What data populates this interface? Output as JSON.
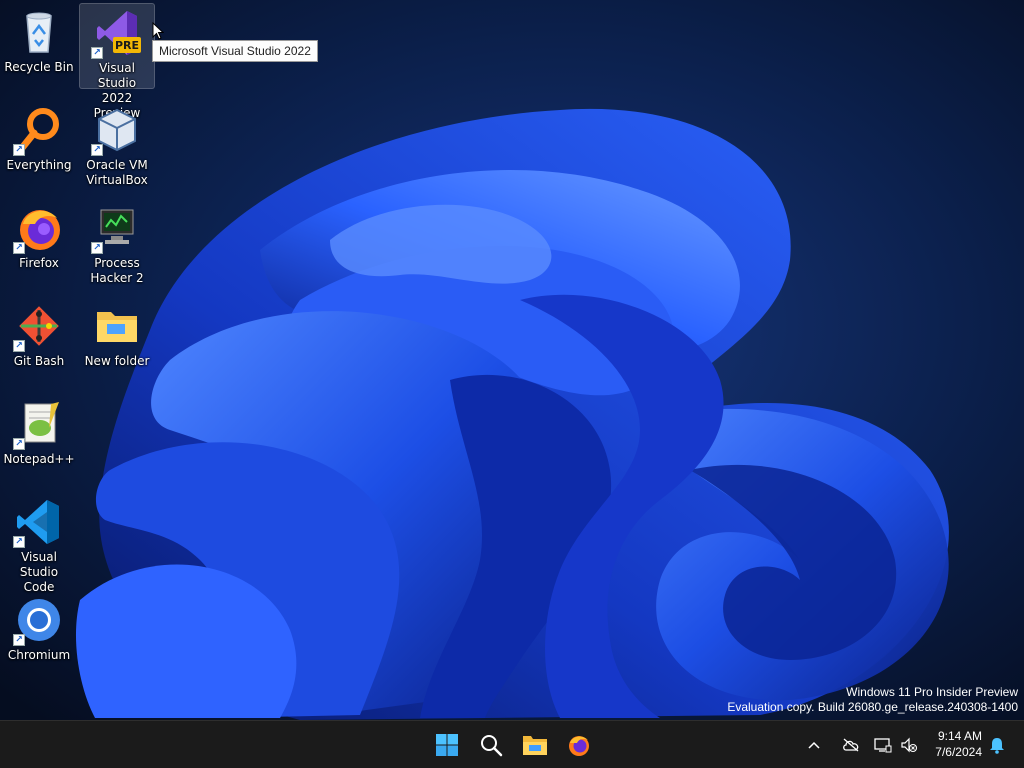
{
  "desktop": {
    "icons": [
      {
        "label": "Recycle Bin",
        "icon": "recycle-bin-icon"
      },
      {
        "label": "Visual Studio 2022 Preview",
        "label_l1": "Visual Studio",
        "label_l2": "2022 Preview",
        "icon": "visual-studio-preview-icon",
        "badge": "PRE"
      },
      {
        "label": "Everything",
        "icon": "everything-search-icon"
      },
      {
        "label": "Oracle VM VirtualBox",
        "label_l1": "Oracle VM",
        "label_l2": "VirtualBox",
        "icon": "virtualbox-icon"
      },
      {
        "label": "Firefox",
        "icon": "firefox-icon"
      },
      {
        "label": "Process Hacker 2",
        "label_l1": "Process",
        "label_l2": "Hacker 2",
        "icon": "process-hacker-icon"
      },
      {
        "label": "Git Bash",
        "icon": "git-bash-icon"
      },
      {
        "label": "New folder",
        "icon": "folder-icon"
      },
      {
        "label": "Notepad++",
        "icon": "notepad-plus-plus-icon"
      },
      {
        "label": "Visual Studio Code",
        "label_l1": "Visual Studio",
        "label_l2": "Code",
        "icon": "vscode-icon"
      },
      {
        "label": "Chromium",
        "icon": "chromium-icon"
      }
    ],
    "tooltip": "Microsoft Visual Studio 2022"
  },
  "watermark": {
    "line1": "Windows 11 Pro Insider Preview",
    "line2": "Evaluation copy. Build 26080.ge_release.240308-1400"
  },
  "taskbar": {
    "pinned": [
      "start-icon",
      "search-icon",
      "file-explorer-icon",
      "firefox-icon"
    ],
    "tray_icons": [
      "chevron-up-icon",
      "cloud-offline-icon",
      "network-icon",
      "volume-muted-icon"
    ],
    "time": "9:14 AM",
    "date": "7/6/2024",
    "notification_icon": "bell-icon"
  },
  "colors": {
    "wallpaper_bg": "#06122a",
    "bloom_blue": "#1a4ff0",
    "taskbar": "#1b1b1b",
    "accent": "#0078d4"
  }
}
